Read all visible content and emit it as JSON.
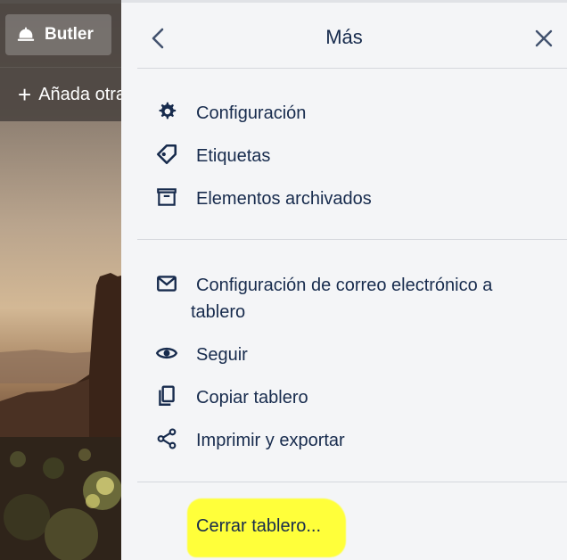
{
  "board": {
    "butler_label": "Butler",
    "add_list_label": "Añada otra lista"
  },
  "panel": {
    "title": "Más",
    "section1": [
      {
        "label": "Configuración",
        "icon": "gear-icon"
      },
      {
        "label": "Etiquetas",
        "icon": "tag-icon"
      },
      {
        "label": "Elementos archivados",
        "icon": "archive-icon"
      }
    ],
    "section2": [
      {
        "label_line1": "Configuración de correo electrónico a",
        "label_line2": "tablero",
        "icon": "email-icon"
      },
      {
        "label": "Seguir",
        "icon": "eye-icon"
      },
      {
        "label": "Copiar tablero",
        "icon": "copy-icon"
      },
      {
        "label": "Imprimir y exportar",
        "icon": "share-icon"
      }
    ],
    "close_board_label": "Cerrar tablero...",
    "highlight_color": "#ffff3a",
    "text_color": "#172b4d"
  }
}
